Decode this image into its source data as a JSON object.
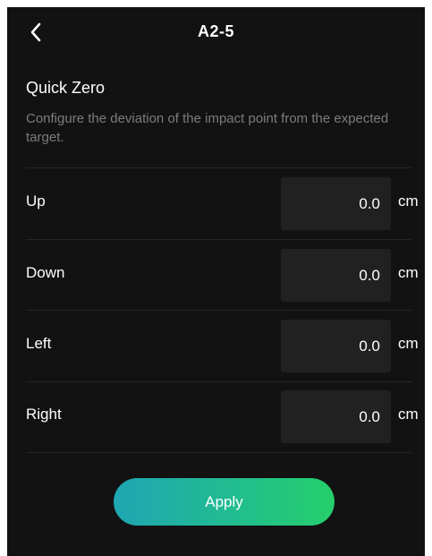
{
  "header": {
    "back_icon": "chevron-left-icon",
    "title": "A2-5"
  },
  "section": {
    "title": "Quick Zero",
    "description": "Configure the deviation of the impact point from the expected target."
  },
  "rows": [
    {
      "label": "Up",
      "value": "0.0",
      "unit": "cm"
    },
    {
      "label": "Down",
      "value": "0.0",
      "unit": "cm"
    },
    {
      "label": "Left",
      "value": "0.0",
      "unit": "cm"
    },
    {
      "label": "Right",
      "value": "0.0",
      "unit": "cm"
    }
  ],
  "apply_label": "Apply",
  "colors": {
    "background": "#121212",
    "field_background": "#212121",
    "description_text": "#7c7c7c",
    "button_gradient_start": "#1fa6b3",
    "button_gradient_end": "#26cf6c"
  }
}
